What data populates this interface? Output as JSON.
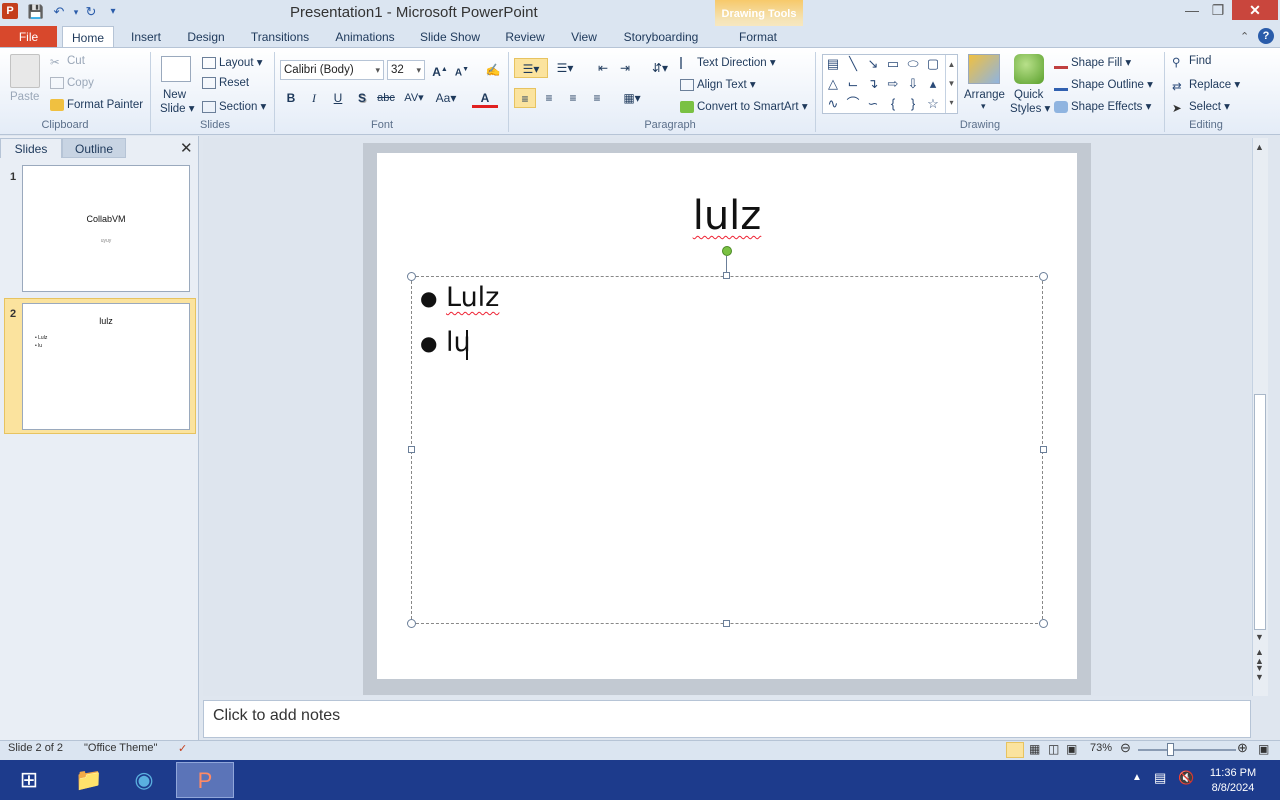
{
  "window": {
    "title": "Presentation1 - Microsoft PowerPoint",
    "contextual_tab_group": "Drawing Tools"
  },
  "tabs": {
    "file": "File",
    "items": [
      "Home",
      "Insert",
      "Design",
      "Transitions",
      "Animations",
      "Slide Show",
      "Review",
      "View",
      "Storyboarding",
      "Format"
    ]
  },
  "ribbon": {
    "clipboard": {
      "paste": "Paste",
      "cut": "Cut",
      "copy": "Copy",
      "format_painter": "Format Painter",
      "label": "Clipboard"
    },
    "slides": {
      "new_slide": "New",
      "new_slide2": "Slide",
      "layout": "Layout",
      "reset": "Reset",
      "section": "Section",
      "label": "Slides"
    },
    "font": {
      "name": "Calibri (Body)",
      "size": "32",
      "label": "Font",
      "bold": "B",
      "italic": "I",
      "underline": "U",
      "shadow": "S",
      "strike": "abc",
      "spacing": "AV",
      "case": "Aa",
      "color": "A"
    },
    "paragraph": {
      "text_direction": "Text Direction",
      "align_text": "Align Text",
      "convert_smartart": "Convert to SmartArt",
      "label": "Paragraph"
    },
    "drawing": {
      "arrange": "Arrange",
      "quick": "Quick",
      "styles": "Styles",
      "shape_fill": "Shape Fill",
      "shape_outline": "Shape Outline",
      "shape_effects": "Shape Effects",
      "label": "Drawing"
    },
    "editing": {
      "find": "Find",
      "replace": "Replace",
      "select": "Select",
      "label": "Editing"
    }
  },
  "pane": {
    "tab_slides": "Slides",
    "tab_outline": "Outline",
    "thumbs": [
      {
        "num": "1",
        "title": "CollabVM",
        "sub": "uyuy"
      },
      {
        "num": "2",
        "title": "lulz",
        "b1": "Lulz",
        "b2": "lu"
      }
    ]
  },
  "slide": {
    "title": "lulz",
    "bullets": [
      "Lulz",
      "lu"
    ]
  },
  "notes": {
    "placeholder": "Click to add notes"
  },
  "status": {
    "slide": "Slide 2 of 2",
    "theme": "\"Office Theme\"",
    "zoom": "73%"
  },
  "taskbar": {
    "time": "11:36 PM",
    "date": "8/8/2024"
  },
  "colors": {
    "file_tab": "#d8482c",
    "accent": "#2a5caa",
    "selected_thumb": "#fbe39e",
    "taskbar": "#1d3b8c"
  }
}
